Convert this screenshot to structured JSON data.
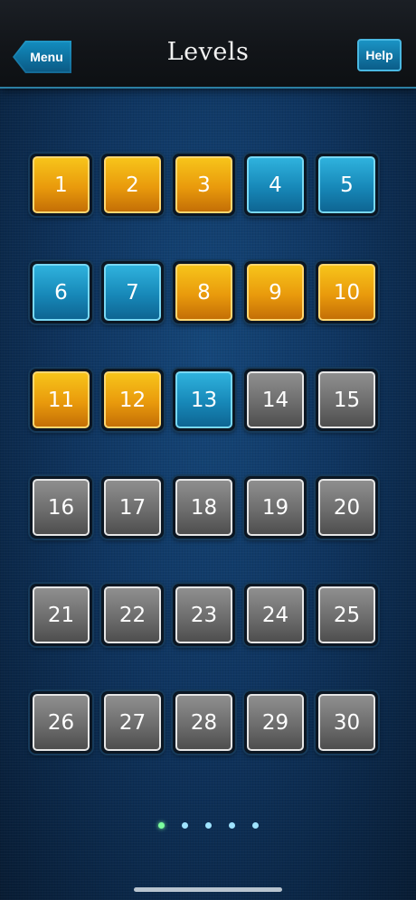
{
  "header": {
    "title": "Levels",
    "menu_label": "Menu",
    "help_label": "Help"
  },
  "colors": {
    "gold": "#e99a0c",
    "blue": "#1788b8",
    "gray": "#6d6d6d",
    "accent": "#2b7fa3"
  },
  "levels": [
    {
      "number": "1",
      "state": "gold"
    },
    {
      "number": "2",
      "state": "gold"
    },
    {
      "number": "3",
      "state": "gold"
    },
    {
      "number": "4",
      "state": "blue"
    },
    {
      "number": "5",
      "state": "blue"
    },
    {
      "number": "6",
      "state": "blue"
    },
    {
      "number": "7",
      "state": "blue"
    },
    {
      "number": "8",
      "state": "gold"
    },
    {
      "number": "9",
      "state": "gold"
    },
    {
      "number": "10",
      "state": "gold"
    },
    {
      "number": "11",
      "state": "gold"
    },
    {
      "number": "12",
      "state": "gold"
    },
    {
      "number": "13",
      "state": "blue"
    },
    {
      "number": "14",
      "state": "gray"
    },
    {
      "number": "15",
      "state": "gray"
    },
    {
      "number": "16",
      "state": "gray"
    },
    {
      "number": "17",
      "state": "gray"
    },
    {
      "number": "18",
      "state": "gray"
    },
    {
      "number": "19",
      "state": "gray"
    },
    {
      "number": "20",
      "state": "gray"
    },
    {
      "number": "21",
      "state": "gray"
    },
    {
      "number": "22",
      "state": "gray"
    },
    {
      "number": "23",
      "state": "gray"
    },
    {
      "number": "24",
      "state": "gray"
    },
    {
      "number": "25",
      "state": "gray"
    },
    {
      "number": "26",
      "state": "gray"
    },
    {
      "number": "27",
      "state": "gray"
    },
    {
      "number": "28",
      "state": "gray"
    },
    {
      "number": "29",
      "state": "gray"
    },
    {
      "number": "30",
      "state": "gray"
    }
  ],
  "pagination": {
    "pages": 5,
    "current": 1
  }
}
